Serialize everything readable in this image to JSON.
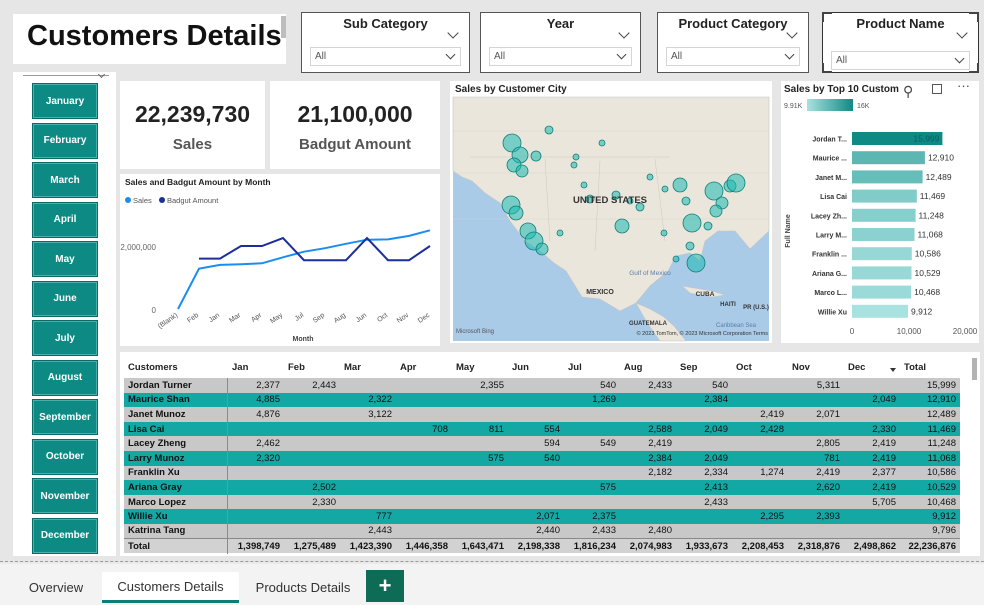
{
  "page": {
    "title": "Customers Details"
  },
  "slicers": [
    {
      "label": "Sub Category",
      "value": "All"
    },
    {
      "label": "Year",
      "value": "All"
    },
    {
      "label": "Product Category",
      "value": "All"
    },
    {
      "label": "Product Name",
      "value": "All"
    }
  ],
  "months": [
    "January",
    "February",
    "March",
    "April",
    "May",
    "June",
    "July",
    "August",
    "September",
    "October",
    "November",
    "December"
  ],
  "kpis": [
    {
      "value": "22,239,730",
      "label": "Sales"
    },
    {
      "value": "21,100,000",
      "label": "Badgut Amount"
    }
  ],
  "line_chart": {
    "title": "Sales and Badgut Amount by Month",
    "legend": [
      "Sales",
      "Badgut Amount"
    ],
    "xlabel": "Month",
    "colors": {
      "sales": "#1a8ef0",
      "budget": "#1b2e99"
    }
  },
  "map": {
    "title": "Sales by Customer City",
    "labels": [
      "UNITED STATES",
      "MEXICO",
      "Gulf of Mexico",
      "CUBA",
      "HAITI",
      "PR (U.S.)",
      "GUATEMALA",
      "Caribbean Sea"
    ],
    "credit_left": "Microsoft Bing",
    "credit_right": "© 2023 TomTom, © 2023 Microsoft Corporation  Terms"
  },
  "bar_chart": {
    "title": "Sales by Top 10 Custom",
    "legend_min": "9.91K",
    "legend_max": "16K",
    "ylabel": "Full Name",
    "ticks": [
      "0",
      "10,000",
      "20,000"
    ]
  },
  "chart_data": [
    {
      "type": "line",
      "title": "Sales and Badgut Amount by Month",
      "xlabel": "Month",
      "categories": [
        "(Blank)",
        "Feb",
        "Jan",
        "Mar",
        "Apr",
        "May",
        "Jul",
        "Sep",
        "Aug",
        "Jun",
        "Oct",
        "Nov",
        "Dec"
      ],
      "yticks": [
        "0",
        "2,000,000"
      ],
      "ylim": [
        0,
        3000000
      ],
      "series": [
        {
          "name": "Sales",
          "values": [
            0,
            1280000,
            1400000,
            1420000,
            1450000,
            1640000,
            1820000,
            1930000,
            2070000,
            2200000,
            2210000,
            2320000,
            2500000
          ]
        },
        {
          "name": "Badgut Amount",
          "values": [
            null,
            1600000,
            1600000,
            2000000,
            2000000,
            2250000,
            1550000,
            1550000,
            1550000,
            2250000,
            1550000,
            1550000,
            2000000
          ]
        }
      ]
    },
    {
      "type": "bar",
      "title": "Sales by Top 10 Custom",
      "ylabel": "Full Name",
      "categories": [
        "Jordan T...",
        "Maurice ...",
        "Janet M...",
        "Lisa Cai",
        "Lacey Zh...",
        "Larry M...",
        "Franklin ...",
        "Ariana G...",
        "Marco L...",
        "Willie Xu"
      ],
      "values": [
        15999,
        12910,
        12489,
        11469,
        11248,
        11068,
        10586,
        10529,
        10468,
        9912
      ],
      "labels": [
        "15,999",
        "12,910",
        "12,489",
        "11,469",
        "11,248",
        "11,068",
        "10,586",
        "10,529",
        "10,468",
        "9,912"
      ],
      "xlim": [
        0,
        20000
      ],
      "colors": {
        "low": "#a8e2e0",
        "high": "#0e8a85"
      }
    },
    {
      "type": "table",
      "columns": [
        "Customers",
        "Jan",
        "Feb",
        "Mar",
        "Apr",
        "May",
        "Jun",
        "Jul",
        "Aug",
        "Sep",
        "Oct",
        "Nov",
        "Dec",
        "Total"
      ],
      "rows": [
        [
          "Jordan Turner",
          "2,377",
          "2,443",
          "",
          "",
          "2,355",
          "",
          "540",
          "2,433",
          "540",
          "",
          "5,311",
          "",
          "15,999"
        ],
        [
          "Maurice Shan",
          "4,885",
          "",
          "2,322",
          "",
          "",
          "",
          "1,269",
          "",
          "2,384",
          "",
          "",
          "2,049",
          "12,910"
        ],
        [
          "Janet Munoz",
          "4,876",
          "",
          "3,122",
          "",
          "",
          "",
          "",
          "",
          "",
          "2,419",
          "2,071",
          "",
          "12,489"
        ],
        [
          "Lisa Cai",
          "",
          "",
          "",
          "708",
          "811",
          "554",
          "",
          "2,588",
          "2,049",
          "2,428",
          "",
          "2,330",
          "11,469"
        ],
        [
          "Lacey Zheng",
          "2,462",
          "",
          "",
          "",
          "",
          "594",
          "549",
          "2,419",
          "",
          "",
          "2,805",
          "2,419",
          "11,248"
        ],
        [
          "Larry Munoz",
          "2,320",
          "",
          "",
          "",
          "575",
          "540",
          "",
          "2,384",
          "2,049",
          "",
          "781",
          "2,419",
          "11,068"
        ],
        [
          "Franklin Xu",
          "",
          "",
          "",
          "",
          "",
          "",
          "",
          "2,182",
          "2,334",
          "1,274",
          "2,419",
          "2,377",
          "10,586"
        ],
        [
          "Ariana Gray",
          "",
          "2,502",
          "",
          "",
          "",
          "",
          "575",
          "",
          "2,413",
          "",
          "2,620",
          "2,419",
          "10,529"
        ],
        [
          "Marco Lopez",
          "",
          "2,330",
          "",
          "",
          "",
          "",
          "",
          "",
          "2,433",
          "",
          "",
          "5,705",
          "10,468"
        ],
        [
          "Willie Xu",
          "",
          "",
          "777",
          "",
          "",
          "2,071",
          "2,375",
          "",
          "",
          "2,295",
          "2,393",
          "",
          "9,912"
        ],
        [
          "Katrina Tang",
          "",
          "",
          "2,443",
          "",
          "",
          "2,440",
          "2,433",
          "2,480",
          "",
          "",
          "",
          "",
          "9,796"
        ]
      ],
      "total": [
        "Total",
        "1,398,749",
        "1,275,489",
        "1,423,390",
        "1,446,358",
        "1,643,471",
        "2,198,338",
        "1,816,234",
        "2,074,983",
        "1,933,673",
        "2,208,453",
        "2,318,876",
        "2,498,862",
        "22,236,876"
      ]
    }
  ],
  "tabs": [
    "Overview",
    "Customers Details",
    "Products Details"
  ],
  "tab_add": "+"
}
